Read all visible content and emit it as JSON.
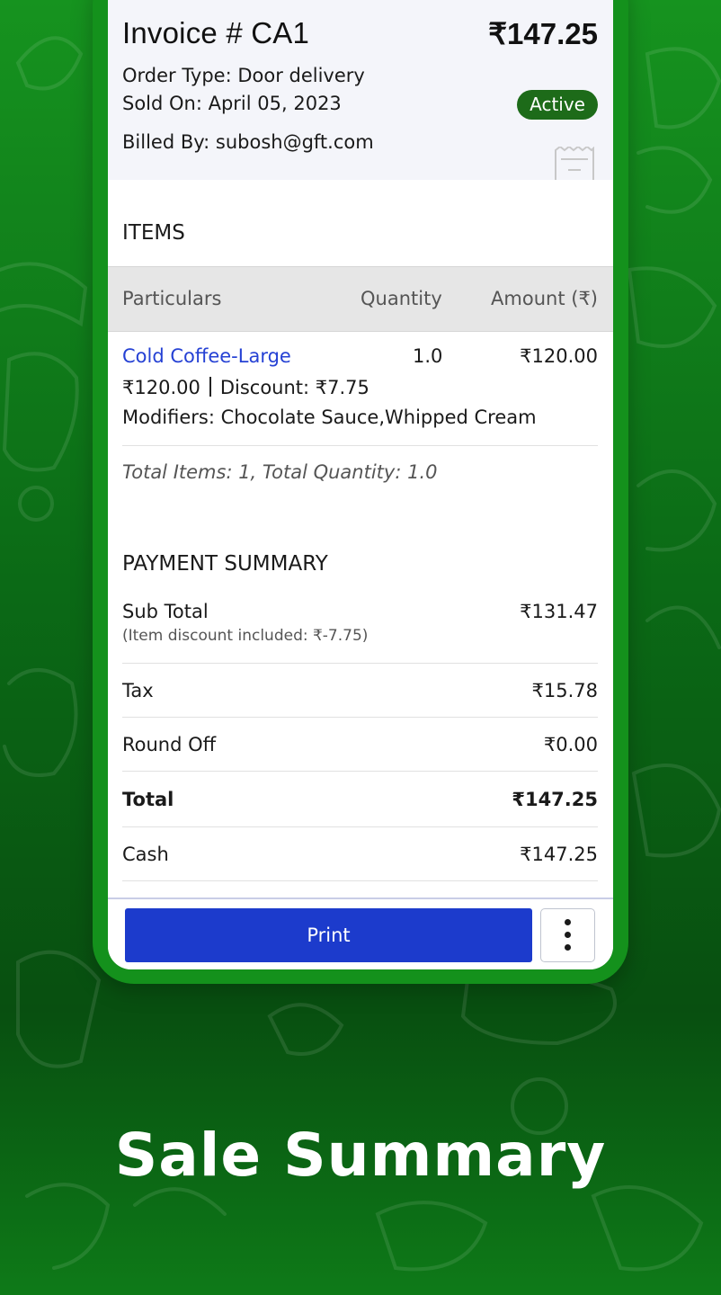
{
  "invoice": {
    "title": "Invoice #  CA1",
    "amount": "₹147.25",
    "order_type": "Order Type: Door delivery",
    "sold_on": "Sold On: April 05, 2023",
    "billed_by": "Billed By: subosh@gft.com",
    "status": "Active"
  },
  "items_section": {
    "title": "ITEMS",
    "columns": [
      "Particulars",
      "Quantity",
      "Amount (₹)"
    ],
    "rows": [
      {
        "name": "Cold Coffee-Large",
        "quantity": "1.0",
        "amount": "₹120.00",
        "price": "₹120.00",
        "discount": "Discount: ₹7.75",
        "modifiers": "Modifiers: Chocolate Sauce,Whipped Cream"
      }
    ],
    "totals": "Total Items: 1, Total Quantity: 1.0"
  },
  "payment_summary": {
    "title": "PAYMENT SUMMARY",
    "subtotal_label": "Sub Total",
    "subtotal_value": "₹131.47",
    "subtotal_note": "(Item discount included: ₹-7.75)",
    "tax_label": "Tax",
    "tax_value": "₹15.78",
    "roundoff_label": "Round Off",
    "roundoff_value": "₹0.00",
    "total_label": "Total",
    "total_value": "₹147.25",
    "cash_label": "Cash",
    "cash_value": "₹147.25"
  },
  "actions": {
    "print_label": "Print",
    "more_icon": "more-vertical-icon"
  },
  "tagline": "Sale Summary",
  "colors": {
    "accent_blue": "#1c3bcc",
    "status_green": "#1d6b19",
    "link_blue": "#2541d4",
    "frame_green": "#14911c"
  }
}
